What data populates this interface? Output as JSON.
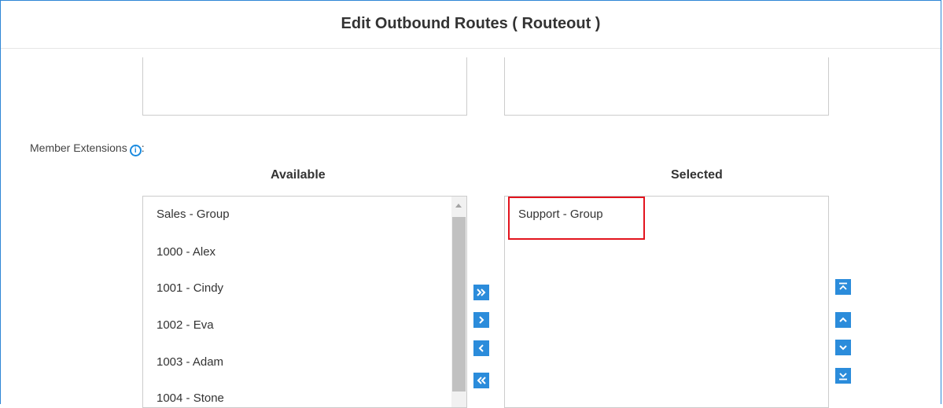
{
  "dialog": {
    "title": "Edit Outbound Routes ( Routeout )"
  },
  "member_extensions": {
    "label": "Member Extensions",
    "label_suffix": ":",
    "available_header": "Available",
    "selected_header": "Selected",
    "available_items": [
      "Sales - Group",
      "1000 - Alex",
      "1001 - Cindy",
      "1002 - Eva",
      "1003 - Adam",
      "1004 - Stone"
    ],
    "selected_items": [
      "Support - Group"
    ]
  },
  "transfer_buttons": [
    "move-all-right",
    "move-right",
    "move-left",
    "move-all-left"
  ],
  "order_buttons": [
    "move-top",
    "move-up",
    "move-down",
    "move-bottom"
  ],
  "colors": {
    "accent": "#2b8cdb",
    "border": "#2e86d6",
    "highlight": "#e3141e"
  }
}
